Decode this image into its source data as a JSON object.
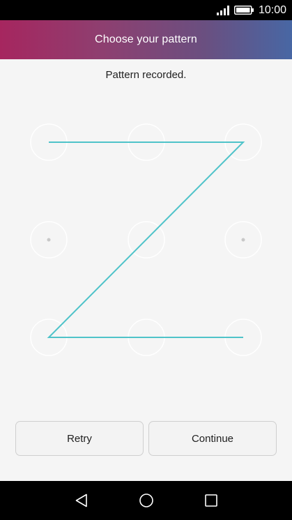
{
  "status_bar": {
    "time": "10:00",
    "icons": [
      "signal-icon",
      "battery-icon"
    ]
  },
  "header": {
    "title": "Choose your pattern"
  },
  "pattern": {
    "message": "Pattern recorded.",
    "grid": "3x3",
    "sequence": [
      1,
      2,
      3,
      5,
      7,
      8,
      9
    ],
    "line_color": "#4fc3c9"
  },
  "buttons": {
    "retry_label": "Retry",
    "continue_label": "Continue"
  },
  "nav_bar": {
    "icons": [
      "back-icon",
      "home-icon",
      "recent-apps-icon"
    ]
  }
}
